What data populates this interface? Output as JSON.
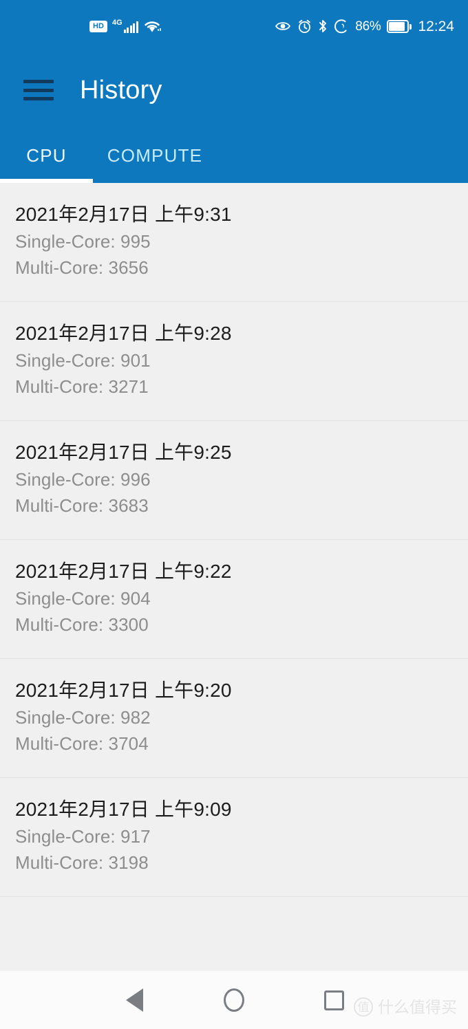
{
  "status_bar": {
    "hd_label": "HD",
    "network_label": "4G",
    "signal_icon": "signal-bars-icon",
    "wifi_icon": "wifi-icon",
    "eye_icon": "eye-comfort-icon",
    "alarm_icon": "alarm-clock-icon",
    "bluetooth_icon": "bluetooth-icon",
    "data_saver_icon": "data-saver-icon",
    "battery_percent": "86%",
    "battery_icon": "battery-icon",
    "time": "12:24"
  },
  "app_bar": {
    "menu_icon": "hamburger-menu-icon",
    "title": "History"
  },
  "tabs": {
    "active_index": 0,
    "items": [
      {
        "label": "CPU"
      },
      {
        "label": "COMPUTE"
      }
    ]
  },
  "list": {
    "single_core_prefix": "Single-Core: ",
    "multi_core_prefix": "Multi-Core: ",
    "items": [
      {
        "date": "2021年2月17日 上午9:31",
        "single_core": "Single-Core: 995",
        "multi_core": "Multi-Core: 3656"
      },
      {
        "date": "2021年2月17日 上午9:28",
        "single_core": "Single-Core: 901",
        "multi_core": "Multi-Core: 3271"
      },
      {
        "date": "2021年2月17日 上午9:25",
        "single_core": "Single-Core: 996",
        "multi_core": "Multi-Core: 3683"
      },
      {
        "date": "2021年2月17日 上午9:22",
        "single_core": "Single-Core: 904",
        "multi_core": "Multi-Core: 3300"
      },
      {
        "date": "2021年2月17日 上午9:20",
        "single_core": "Single-Core: 982",
        "multi_core": "Multi-Core: 3704"
      },
      {
        "date": "2021年2月17日 上午9:09",
        "single_core": "Single-Core: 917",
        "multi_core": "Multi-Core: 3198"
      }
    ]
  },
  "nav_bar": {
    "back_icon": "back-triangle-icon",
    "home_icon": "home-circle-icon",
    "recents_icon": "recents-square-icon"
  },
  "watermark": {
    "logo_char": "值",
    "text": "什么值得买"
  },
  "colors": {
    "primary": "#0d78bd",
    "menu_icon": "#123a5e",
    "page_bg": "#f0f0f0",
    "date_text": "#1c1c1c",
    "score_text": "#8d8d8d",
    "nav_icon": "#7a7d82",
    "watermark": "#e4e4e4"
  }
}
